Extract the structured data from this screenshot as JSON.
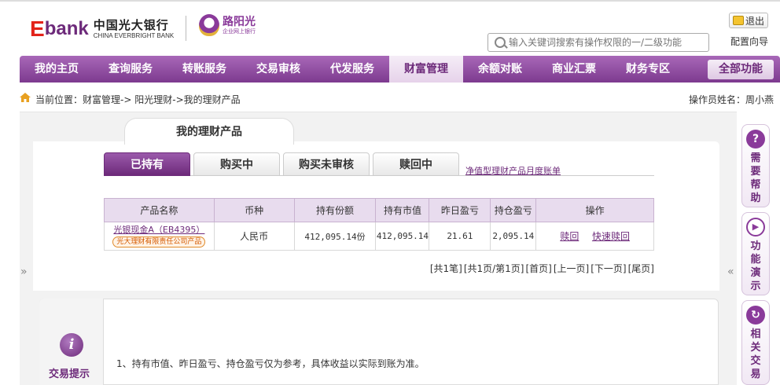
{
  "header": {
    "logo_e": "E",
    "logo_bank": "bank",
    "bank_name_cn": "中国光大银行",
    "bank_name_en": "CHINA EVERBRIGHT BANK",
    "sub_brand": "路阳光",
    "sub_brand_desc": "企业网上银行",
    "logout_label": "退出",
    "search_placeholder": "输入关键词搜索有操作权限的一/二级功能",
    "config_label": "配置向导"
  },
  "nav": {
    "items": [
      {
        "label": "我的主页"
      },
      {
        "label": "查询服务"
      },
      {
        "label": "转账服务"
      },
      {
        "label": "交易审核"
      },
      {
        "label": "代发服务"
      },
      {
        "label": "财富管理",
        "active": true
      },
      {
        "label": "余额对账"
      },
      {
        "label": "商业汇票"
      },
      {
        "label": "财务专区"
      }
    ],
    "all_label": "全部功能"
  },
  "breadcrumb": {
    "prefix": "当前位置：",
    "items": [
      "财富管理",
      "阳光理财",
      "我的理财产品"
    ],
    "separator": "->"
  },
  "operator": {
    "label": "操作员姓名：",
    "name": "周小燕"
  },
  "page": {
    "title": "我的理财产品"
  },
  "subtabs": {
    "items": [
      {
        "label": "已持有",
        "active": true
      },
      {
        "label": "购买中"
      },
      {
        "label": "购买未审核"
      },
      {
        "label": "赎回中"
      }
    ],
    "link_label": "净值型理财产品月度账单"
  },
  "table": {
    "headers": [
      "产品名称",
      "币种",
      "持有份额",
      "持有市值",
      "昨日盈亏",
      "持仓盈亏",
      "操作"
    ],
    "rows": [
      {
        "product_name": "光银现金A（EB4395）",
        "product_badge": "光大理财有限责任公司产品",
        "currency": "人民币",
        "shares": "412,095.14份",
        "market_value": "412,095.14",
        "yesterday_pnl": "21.61",
        "position_pnl": "2,095.14",
        "op_redeem": "赎回",
        "op_quick_redeem": "快速赎回"
      }
    ]
  },
  "pager": {
    "total": "[共1笔]",
    "pages": "[共1页/第1页]",
    "first": "[首页]",
    "prev": "[上一页]",
    "next": "[下一页]",
    "last": "[尾页]"
  },
  "tips": {
    "icon": "i",
    "label": "交易提示",
    "text": "1、持有市值、昨日盈亏、持仓盈亏仅为参考，具体收益以实际到账为准。"
  },
  "side_panel": {
    "help": {
      "icon": "?",
      "label": "需要帮助"
    },
    "demo": {
      "icon": "▶",
      "label": "功能演示"
    },
    "related": {
      "icon": "↻",
      "label": "相关交易"
    }
  },
  "arrows": {
    "left": "»",
    "right": "«"
  },
  "colors": {
    "brand_purple": "#7d3a8f",
    "brand_red": "#e2231a",
    "badge_orange": "#e08a2a"
  }
}
